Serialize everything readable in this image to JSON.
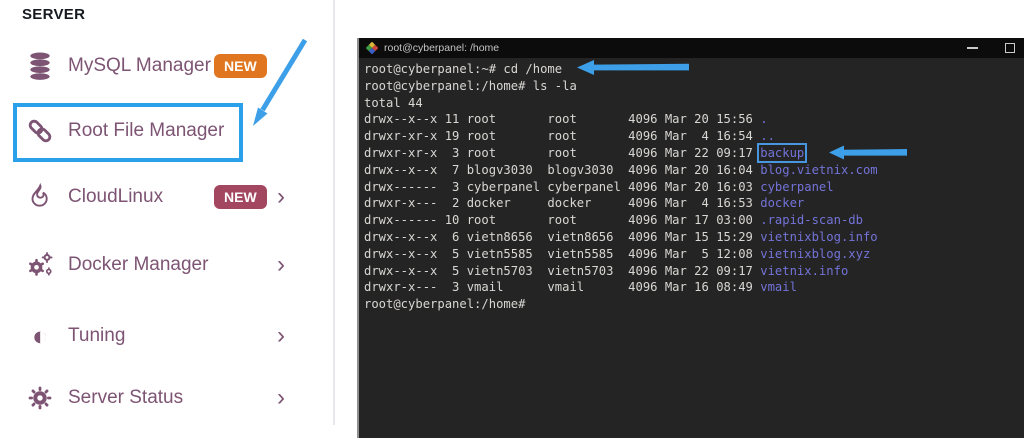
{
  "sidebar": {
    "section_label": "SERVER",
    "items": [
      {
        "label": "MySQL Manager",
        "icon": "database-icon",
        "badge": "NEW",
        "badge_color": "#e0761f",
        "chevron": false,
        "highlighted": false
      },
      {
        "label": "Root File Manager",
        "icon": "chain-link-icon",
        "badge": "",
        "chevron": false,
        "highlighted": true
      },
      {
        "label": "CloudLinux",
        "icon": "flame-icon",
        "badge": "NEW",
        "badge_color": "#a34660",
        "chevron": true,
        "highlighted": false
      },
      {
        "label": "Docker Manager",
        "icon": "gears-icon",
        "badge": "",
        "chevron": true,
        "highlighted": false
      },
      {
        "label": "Tuning",
        "icon": "contrast-icon",
        "badge": "",
        "chevron": true,
        "highlighted": false
      },
      {
        "label": "Server Status",
        "icon": "gear-icon",
        "badge": "",
        "chevron": true,
        "highlighted": false
      }
    ],
    "chevron_glyph": "›",
    "contrast_glyph": "◐"
  },
  "terminal": {
    "title": "root@cyberpanel: /home",
    "window_controls": [
      "minimize",
      "maximize"
    ],
    "lines": [
      {
        "text": "root@cyberpanel:~# cd /home",
        "arrow": true
      },
      {
        "text": "root@cyberpanel:/home# ls -la"
      },
      {
        "text": "total 44"
      },
      {
        "text": "drwx--x--x 11 root       root       4096 Mar 20 15:56 ",
        "dir": "."
      },
      {
        "text": "drwxr-xr-x 19 root       root       4096 Mar  4 16:54 ",
        "dir": ".."
      },
      {
        "text": "drwxr-xr-x  3 root       root       4096 Mar 22 09:17 ",
        "dir": "backup",
        "boxed": true,
        "arrow": true
      },
      {
        "text": "drwx--x--x  7 blogv3030  blogv3030  4096 Mar 20 16:04 ",
        "dir": "blog.vietnix.com"
      },
      {
        "text": "drwx------  3 cyberpanel cyberpanel 4096 Mar 20 16:03 ",
        "dir": "cyberpanel"
      },
      {
        "text": "drwxr-x---  2 docker     docker     4096 Mar  4 16:53 ",
        "dir": "docker"
      },
      {
        "text": "drwx------ 10 root       root       4096 Mar 17 03:00 ",
        "dir": ".rapid-scan-db"
      },
      {
        "text": "drwx--x--x  6 vietn8656  vietn8656  4096 Mar 15 15:29 ",
        "dir": "vietnixblog.info"
      },
      {
        "text": "drwx--x--x  5 vietn5585  vietn5585  4096 Mar  5 12:08 ",
        "dir": "vietnixblog.xyz"
      },
      {
        "text": "drwx--x--x  5 vietn5703  vietn5703  4096 Mar 22 09:17 ",
        "dir": "vietnix.info"
      },
      {
        "text": "drwxr-x---  3 vmail      vmail      4096 Mar 16 08:49 ",
        "dir": "vmail"
      },
      {
        "text": "root@cyberpanel:/home#"
      }
    ]
  },
  "colors": {
    "sidebar_text": "#7d5473",
    "badge_orange": "#e0761f",
    "badge_rose": "#a34660",
    "annotation_blue": "#3d9fe8",
    "highlight_border": "#2ba0ea",
    "terminal_bg": "#242424",
    "terminal_titlebar_bg": "#0c0c0c",
    "terminal_text": "#d9d7d3",
    "directory_blue": "#7373d9"
  }
}
